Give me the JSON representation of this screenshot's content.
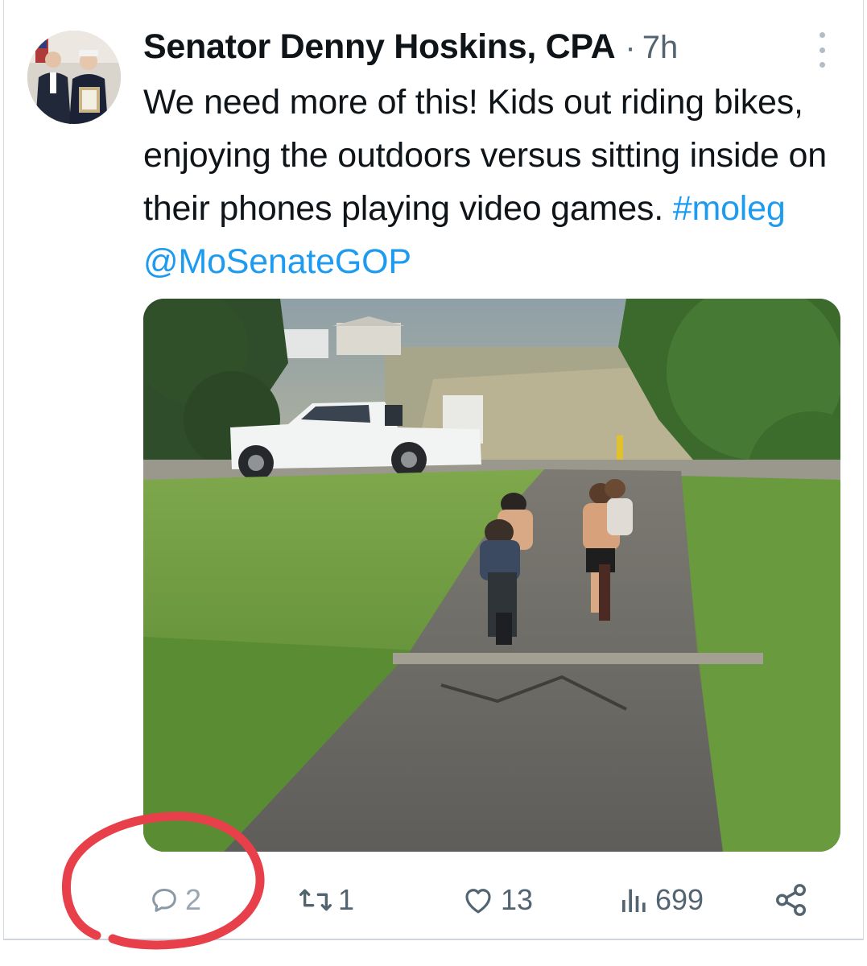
{
  "tweet": {
    "author_name": "Senator Denny Hoskins, CPA",
    "separator": "·",
    "time": "7h",
    "text_plain": "We need more of this!  Kids out riding bikes, enjoying the outdoors versus sitting inside on their phones playing video games.",
    "hashtag": "#moleg",
    "mention": "@MoSenateGOP"
  },
  "actions": {
    "replies": "2",
    "retweets": "1",
    "likes": "13",
    "views": "699"
  },
  "icons": {
    "reply": "reply-icon",
    "retweet": "retweet-icon",
    "like": "heart-icon",
    "views": "views-bar-icon",
    "share": "share-icon",
    "more": "more-vertical-icon"
  },
  "colors": {
    "link": "#1d9bf0",
    "secondary": "#536471",
    "annotation": "#e8404a"
  }
}
